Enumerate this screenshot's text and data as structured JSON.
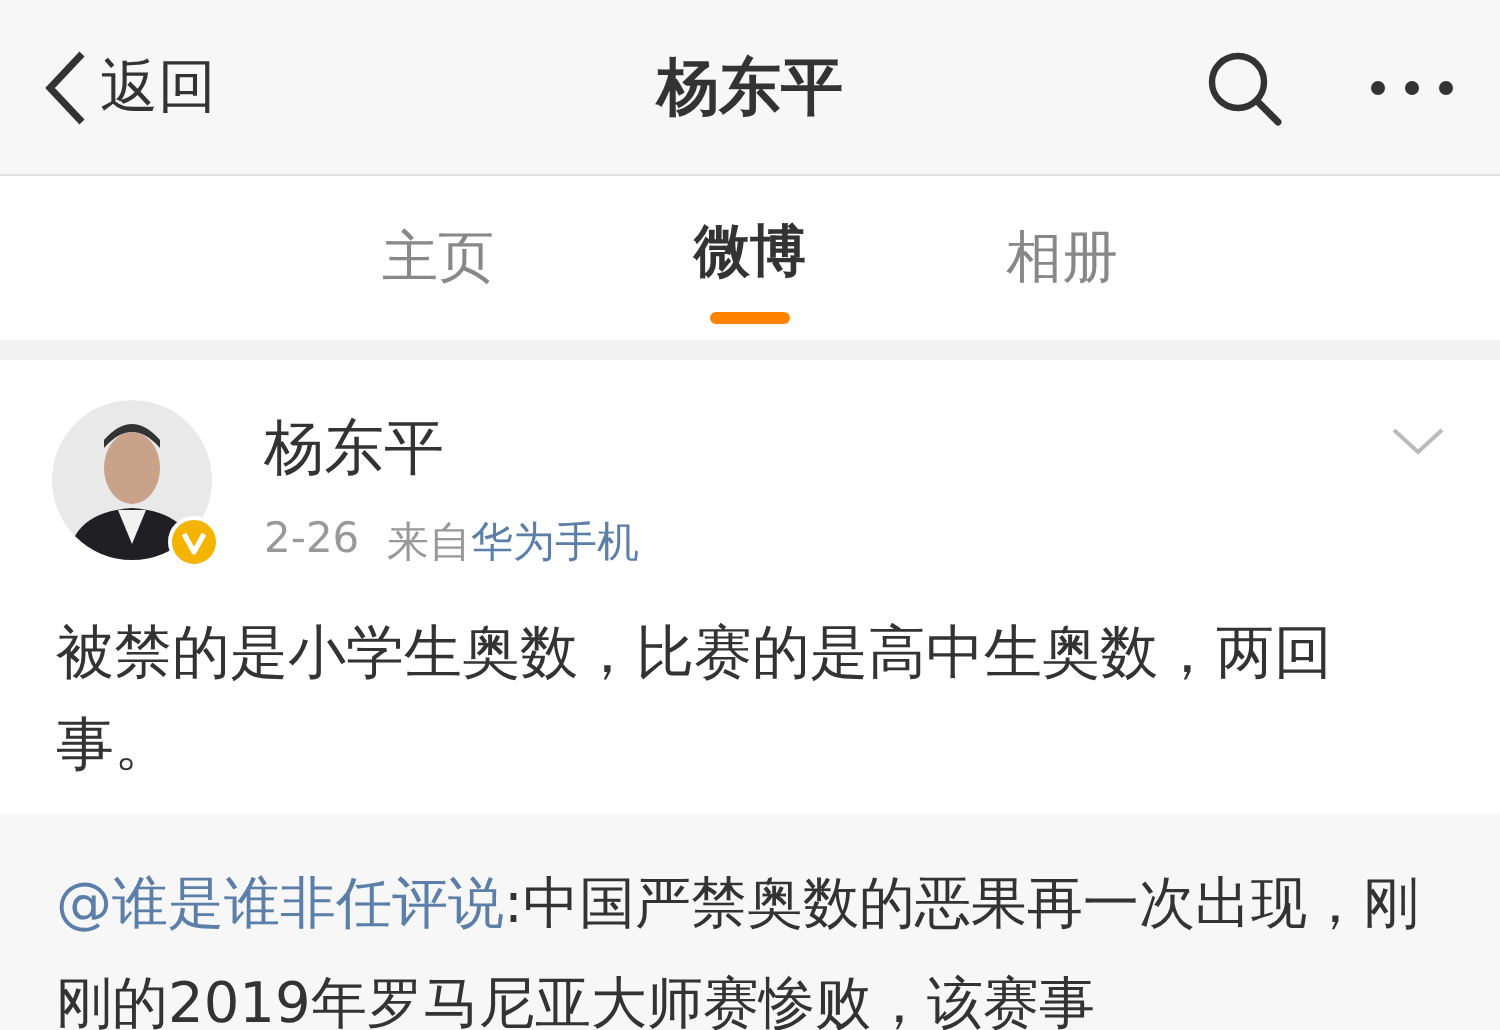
{
  "nav": {
    "back": "返回",
    "title": "杨东平"
  },
  "tabs": [
    {
      "label": "主页",
      "selected": false
    },
    {
      "label": "微博",
      "selected": true
    },
    {
      "label": "相册",
      "selected": false
    }
  ],
  "post": {
    "author": "杨东平",
    "verified": true,
    "date": "2-26",
    "source_prefix": "来自",
    "source": "华为手机",
    "text": "被禁的是小学生奥数，比赛的是高中生奥数，两回事。",
    "repost": {
      "author": "@谁是谁非任评说",
      "text": ":中国严禁奥数的恶果再一次出现，刚刚的2019年罗马尼亚大师赛惨败，该赛事"
    }
  }
}
